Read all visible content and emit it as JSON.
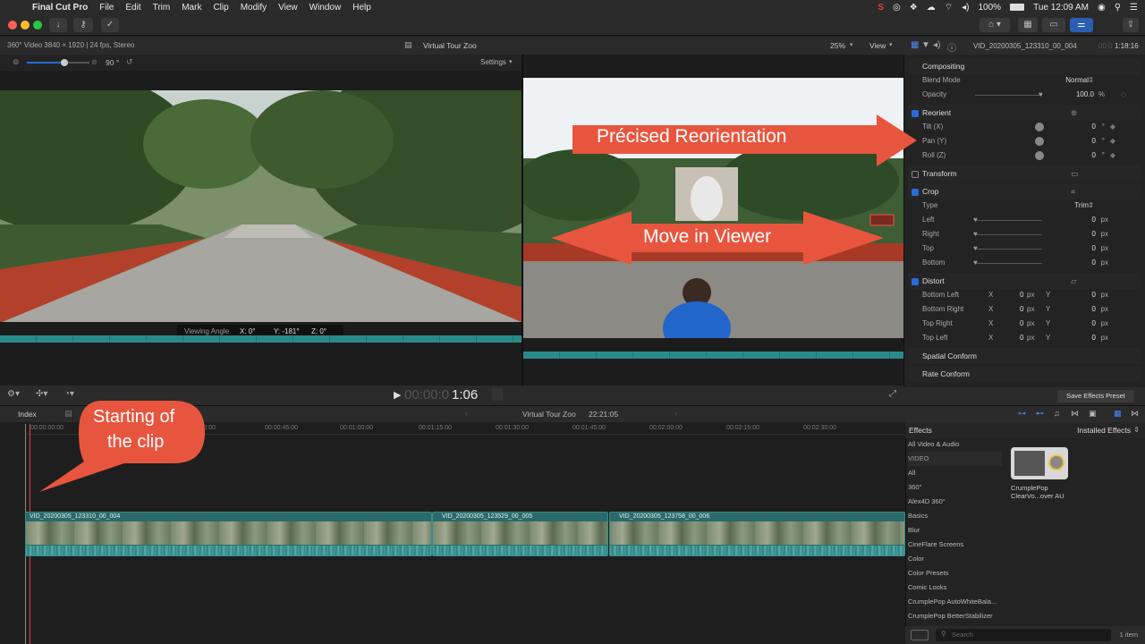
{
  "menubar": {
    "app": "Final Cut Pro",
    "items": [
      "File",
      "Edit",
      "Trim",
      "Mark",
      "Clip",
      "Modify",
      "View",
      "Window",
      "Help"
    ],
    "battery": "100%",
    "clock": "Tue 12:09 AM"
  },
  "viewer": {
    "left_info": "360° Video 3840 × 1920 | 24 fps, Stereo",
    "title": "Virtual Tour Zoo",
    "zoom": "25%",
    "view_label": "View",
    "angle_value": "90 °",
    "settings_label": "Settings",
    "viewing_angle_label": "Viewing Angle",
    "viewing_x": "X: 0°",
    "viewing_y": "Y: -181°",
    "viewing_z": "Z: 0°",
    "timecode_dim": "00:00:0",
    "timecode_bright": "1:06"
  },
  "inspector": {
    "clip_name": "VID_20200305_123310_00_004",
    "duration_dim": "00:0",
    "duration_bright": "1:18:16",
    "compositing": "Compositing",
    "blend_mode_label": "Blend Mode",
    "blend_mode_value": "Normal",
    "opacity_label": "Opacity",
    "opacity_value": "100.0",
    "opacity_unit": "%",
    "reorient": "Reorient",
    "tilt_label": "Tilt (X)",
    "pan_label": "Pan (Y)",
    "roll_label": "Roll (Z)",
    "angle_zero": "0",
    "deg": "°",
    "transform": "Transform",
    "crop": "Crop",
    "type_label": "Type",
    "type_value": "Trim",
    "left_label": "Left",
    "right_label": "Right",
    "top_label": "Top",
    "bottom_label": "Bottom",
    "zero": "0",
    "px": "px",
    "distort": "Distort",
    "bottom_left": "Bottom Left",
    "bottom_right": "Bottom Right",
    "top_right": "Top Right",
    "top_left": "Top Left",
    "x": "X",
    "y": "Y",
    "spatial_conform": "Spatial Conform",
    "rate_conform": "Rate Conform",
    "save_preset": "Save Effects Preset"
  },
  "timeline": {
    "index_label": "Index",
    "project_name": "Virtual Tour Zoo",
    "project_duration": "22:21:05",
    "ruler": [
      "00:00:00:00",
      "00:00:30:00",
      "00:00:45:00",
      "00:01:00:00",
      "00:01:15:00",
      "00:01:30:00",
      "00:01:45:00",
      "00:02:00:00",
      "00:02:15:00",
      "00:02:30:00"
    ],
    "clips": [
      "VID_20200305_123310_00_004",
      "VID_20200305_123529_00_005",
      "VID_20200305_123758_00_006"
    ]
  },
  "effects": {
    "header": "Effects",
    "installed": "Installed Effects",
    "categories": [
      "All Video & Audio",
      "VIDEO",
      "All",
      "360°",
      "Alex4D 360°",
      "Basics",
      "Blur",
      "CineFlare Screens",
      "Color",
      "Color Presets",
      "Comic Looks",
      "CrumplePop AutoWhiteBala...",
      "CrumplePop BetterStabilizer"
    ],
    "effect_name_1": "CrumplePop",
    "effect_name_2": "ClearVo...over AU",
    "search_placeholder": "Search",
    "count": "1 item"
  },
  "callouts": {
    "reorientation": "Précised Reorientation",
    "move": "Move in Viewer",
    "start_line1": "Starting of",
    "start_line2": "the clip"
  },
  "colors": {
    "accent_blue": "#2a6bd8",
    "callout": "#e8553e",
    "clip_teal": "#2a6a6a"
  }
}
